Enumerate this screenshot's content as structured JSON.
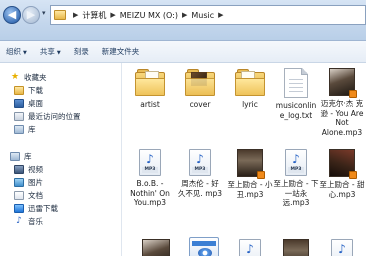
{
  "window": {
    "breadcrumbs": [
      "计算机",
      "MEIZU MX (O:)",
      "Music"
    ]
  },
  "toolbar": {
    "organize": "组织",
    "share": "共享",
    "burn": "刻录",
    "new_folder": "新建文件夹"
  },
  "sidebar": {
    "favorites": {
      "label": "收藏夹",
      "items": [
        "下载",
        "桌面",
        "最近访问的位置",
        "库"
      ]
    },
    "libraries": {
      "label": "库",
      "items": [
        "视频",
        "图片",
        "文档",
        "迅雷下载",
        "音乐"
      ]
    }
  },
  "files": [
    {
      "name": "artist",
      "kind": "folder"
    },
    {
      "name": "cover",
      "kind": "folder-photo"
    },
    {
      "name": "lyric",
      "kind": "folder"
    },
    {
      "name": "musiconline_log.txt",
      "label": "musiconlin e_log.txt",
      "kind": "text"
    },
    {
      "name": "迈克尔·杰克逊 - You Are Not Alone.mp3",
      "label": "迈克尔·杰 克逊 - You Are Not Alone.mp3",
      "kind": "mp3-photo"
    },
    {
      "name": "B.o.B. - Nothin' On You.mp3",
      "label": "B.o.B. - Nothin' On You.mp3",
      "kind": "mp3"
    },
    {
      "name": "周杰伦 - 好久不见.mp3",
      "label": "周杰伦 - 好 久不见. mp3",
      "kind": "mp3"
    },
    {
      "name": "至上励合 - 小丑.mp3",
      "label": "至上励合 - 小丑.mp3",
      "kind": "mp3-photo"
    },
    {
      "name": "至上励合 - 下一站永远.mp3",
      "label": "至上励合 - 下一站永 远.mp3",
      "kind": "mp3"
    },
    {
      "name": "至上励合 - 甜心.mp3",
      "label": "至上励合 - 甜心.mp3",
      "kind": "mp3-photo"
    }
  ],
  "icon_tags": {
    "mp3": "MP3"
  },
  "colors": {
    "titlebar": "#c3d6ec",
    "folder": "#efc35a",
    "mp3_note": "#2561c4",
    "favorites_star": "#e8b000"
  }
}
